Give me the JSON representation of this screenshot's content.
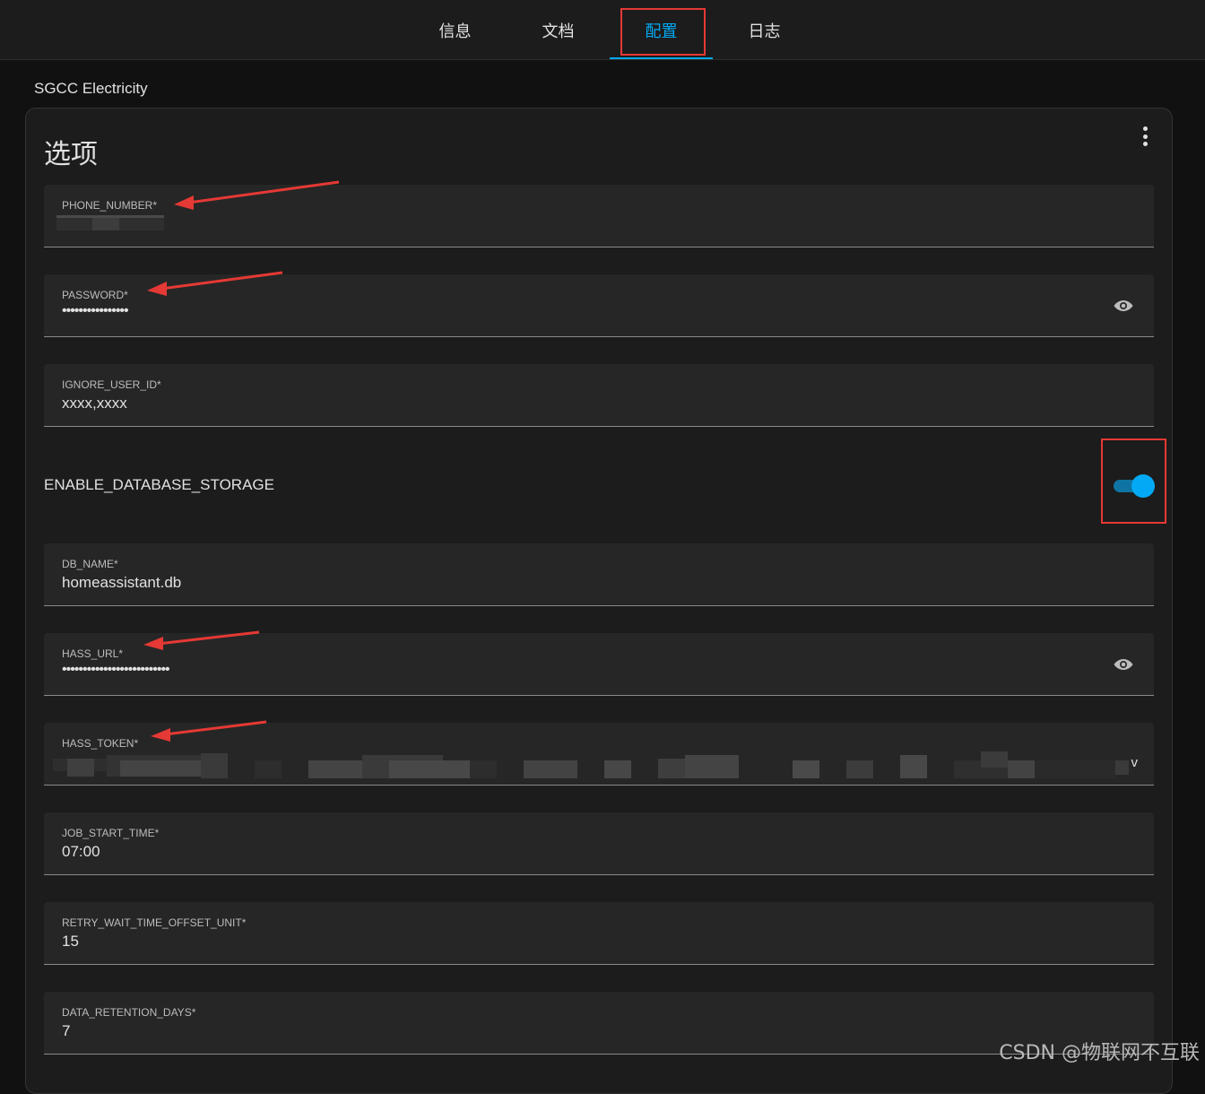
{
  "tabs": [
    {
      "label": "信息",
      "active": false
    },
    {
      "label": "文档",
      "active": false
    },
    {
      "label": "配置",
      "active": true
    },
    {
      "label": "日志",
      "active": false
    }
  ],
  "addon_name": "SGCC Electricity",
  "card": {
    "title": "选项",
    "fields": {
      "phone_number": {
        "label": "PHONE_NUMBER*",
        "value": ""
      },
      "password": {
        "label": "PASSWORD*",
        "value": "••••••••••••••••"
      },
      "ignore_user_id": {
        "label": "IGNORE_USER_ID*",
        "value": "xxxx,xxxx"
      },
      "db_name": {
        "label": "DB_NAME*",
        "value": "homeassistant.db"
      },
      "hass_url": {
        "label": "HASS_URL*",
        "value": "••••••••••••••••••••••••••"
      },
      "hass_token": {
        "label": "HASS_TOKEN*",
        "value": ""
      },
      "job_start_time": {
        "label": "JOB_START_TIME*",
        "value": "07:00"
      },
      "retry_wait": {
        "label": "RETRY_WAIT_TIME_OFFSET_UNIT*",
        "value": "15"
      },
      "data_retention": {
        "label": "DATA_RETENTION_DAYS*",
        "value": "7"
      }
    },
    "toggle": {
      "label": "ENABLE_DATABASE_STORAGE",
      "enabled": true
    }
  },
  "watermark": "CSDN @物联网不互联",
  "colors": {
    "accent": "#03a9f4",
    "annotation": "#e53935",
    "background": "#111111",
    "card": "#1c1c1c"
  }
}
